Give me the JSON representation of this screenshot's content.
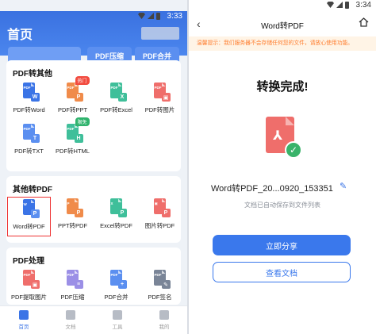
{
  "left": {
    "status_time": "3:33",
    "title": "首页",
    "header_chips": [
      "",
      "PDF压缩",
      "PDF合并"
    ],
    "sections": [
      {
        "title": "PDF转其他",
        "tiles": [
          {
            "label": "PDF转Word",
            "doc": "PDF",
            "badge": "W",
            "color": "#3b74e6",
            "badge_color": "#3b74e6"
          },
          {
            "label": "PDF转PPT",
            "doc": "PDF",
            "badge": "P",
            "color": "#f08b4a",
            "badge_color": "#f08b4a",
            "tag": "热门",
            "tag_color": "#f24b3f"
          },
          {
            "label": "PDF转Excel",
            "doc": "PDF",
            "badge": "X",
            "color": "#3fbf9a",
            "badge_color": "#3fbf9a"
          },
          {
            "label": "PDF转图片",
            "doc": "PDF",
            "badge": "▣",
            "color": "#ef6e6b",
            "badge_color": "#ef6e6b"
          },
          {
            "label": "PDF转TXT",
            "doc": "PDF",
            "badge": "T",
            "color": "#5b8ff0",
            "badge_color": "#5b8ff0"
          },
          {
            "label": "PDF转HTML",
            "doc": "PDF",
            "badge": "H",
            "color": "#3fbf9a",
            "badge_color": "#3fbf9a",
            "tag": "限免",
            "tag_color": "#2fb36d"
          }
        ]
      },
      {
        "title": "其他转PDF",
        "tiles": [
          {
            "label": "Word转PDF",
            "doc": "W",
            "badge": "P",
            "color": "#3b74e6",
            "badge_color": "#5b8ff0",
            "selected": true
          },
          {
            "label": "PPT转PDF",
            "doc": "P",
            "badge": "P",
            "color": "#f08b4a",
            "badge_color": "#f08b4a"
          },
          {
            "label": "Excel转PDF",
            "doc": "X",
            "badge": "P",
            "color": "#3fbf9a",
            "badge_color": "#3fbf9a"
          },
          {
            "label": "图片转PDF",
            "doc": "▣",
            "badge": "P",
            "color": "#ef6e6b",
            "badge_color": "#ef6e6b"
          }
        ]
      },
      {
        "title": "PDF处理",
        "tiles": [
          {
            "label": "PDF提取图片",
            "doc": "PDF",
            "badge": "▣",
            "color": "#ef6e6b",
            "badge_color": "#ef6e6b"
          },
          {
            "label": "PDF压缩",
            "doc": "PDF",
            "badge": "≡",
            "color": "#9b8fe6",
            "badge_color": "#9b8fe6"
          },
          {
            "label": "PDF合并",
            "doc": "PDF",
            "badge": "+",
            "color": "#5b8ff0",
            "badge_color": "#5b8ff0"
          },
          {
            "label": "PDF签名",
            "doc": "PDF",
            "badge": "✎",
            "color": "#7a8597",
            "badge_color": "#7a8597"
          }
        ]
      }
    ],
    "nav": [
      {
        "label": "首页",
        "icon": "home-icon",
        "active": true
      },
      {
        "label": "文档",
        "icon": "folder-icon"
      },
      {
        "label": "工具",
        "icon": "toolbox-icon"
      },
      {
        "label": "我的",
        "icon": "user-icon"
      }
    ]
  },
  "right": {
    "status_time": "3:34",
    "title": "Word转PDF",
    "notice": "温馨提示：我们服务器不会存储任何您的文件，请放心使用功能。",
    "done_title": "转换完成!",
    "file_name": "Word转PDF_20...0920_153351",
    "saved_hint": "文档已自动保存到文件列表",
    "share_button": "立即分享",
    "view_button": "查看文档"
  },
  "colors": {
    "brand": "#3a78ec",
    "notice": "#ff7d2e",
    "success": "#39b36a",
    "pdf_red": "#ef6e6b"
  }
}
